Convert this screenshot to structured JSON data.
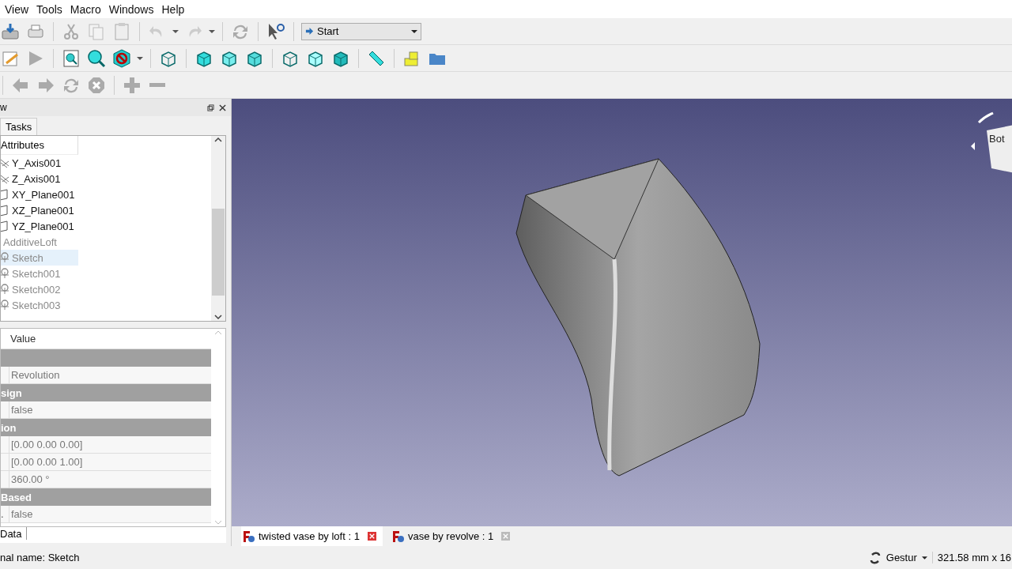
{
  "menu": [
    "View",
    "Tools",
    "Macro",
    "Windows",
    "Help"
  ],
  "workbench": {
    "value": "Start"
  },
  "combo_view": {
    "title": "w",
    "tabs": [
      {
        "label": "Tasks",
        "selected": true
      }
    ]
  },
  "tree": {
    "header": "Attributes",
    "items": [
      {
        "label": "Y_Axis001",
        "kind": "axis",
        "hidden": false,
        "selected": false
      },
      {
        "label": "Z_Axis001",
        "kind": "axis",
        "hidden": false,
        "selected": false
      },
      {
        "label": "XY_Plane001",
        "kind": "plane",
        "hidden": false,
        "selected": false
      },
      {
        "label": "XZ_Plane001",
        "kind": "plane",
        "hidden": false,
        "selected": false
      },
      {
        "label": "YZ_Plane001",
        "kind": "plane",
        "hidden": false,
        "selected": false
      },
      {
        "label": "AdditiveLoft",
        "kind": "feature",
        "hidden": true,
        "selected": false
      },
      {
        "label": "Sketch",
        "kind": "sketch",
        "hidden": true,
        "selected": true
      },
      {
        "label": "Sketch001",
        "kind": "sketch",
        "hidden": true,
        "selected": false
      },
      {
        "label": "Sketch002",
        "kind": "sketch",
        "hidden": true,
        "selected": false
      },
      {
        "label": "Sketch003",
        "kind": "sketch",
        "hidden": true,
        "selected": false
      }
    ]
  },
  "properties": {
    "header": "Value",
    "rows": [
      {
        "kind": "group"
      },
      {
        "kind": "property",
        "value": "Revolution"
      },
      {
        "kind": "group",
        "name": "sign"
      },
      {
        "kind": "property",
        "value": "false"
      },
      {
        "kind": "group",
        "name": "ion"
      },
      {
        "kind": "property",
        "value": "[0.00 0.00 0.00]"
      },
      {
        "kind": "property",
        "value": "[0.00 0.00 1.00]"
      },
      {
        "kind": "property",
        "value": "360.00 °"
      },
      {
        "kind": "group",
        "name": "Based"
      },
      {
        "kind": "property",
        "name": ".",
        "value": "false"
      }
    ],
    "tabs": [
      {
        "label": "Data",
        "selected": true
      }
    ]
  },
  "nav_cube": {
    "face": "Bot"
  },
  "documents": [
    {
      "label": "twisted vase by loft : 1",
      "selected": true
    },
    {
      "label": "vase by revolve : 1",
      "selected": false
    }
  ],
  "status_bar": {
    "message": "nal name: Sketch",
    "navigation": "Gestur",
    "dimensions": "321.58 mm x 16"
  }
}
